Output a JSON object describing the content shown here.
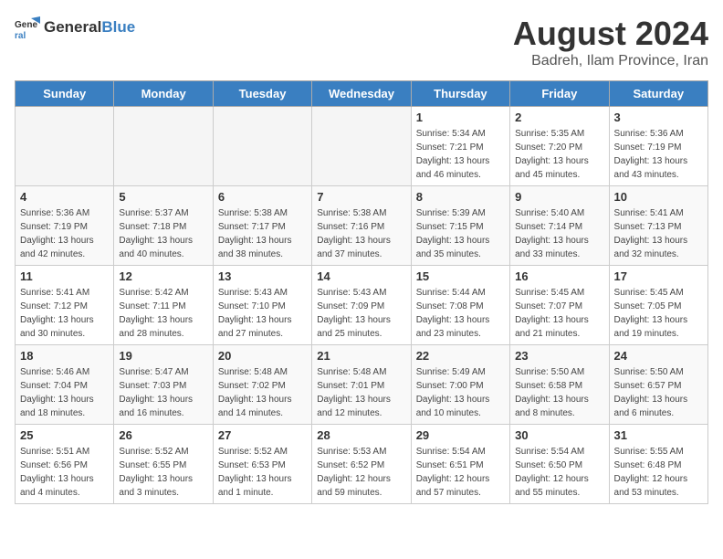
{
  "logo": {
    "text_general": "General",
    "text_blue": "Blue"
  },
  "title": "August 2024",
  "location": "Badreh, Ilam Province, Iran",
  "days_of_week": [
    "Sunday",
    "Monday",
    "Tuesday",
    "Wednesday",
    "Thursday",
    "Friday",
    "Saturday"
  ],
  "weeks": [
    [
      {
        "day": "",
        "empty": true
      },
      {
        "day": "",
        "empty": true
      },
      {
        "day": "",
        "empty": true
      },
      {
        "day": "",
        "empty": true
      },
      {
        "day": "1",
        "sunrise": "5:34 AM",
        "sunset": "7:21 PM",
        "daylight": "13 hours and 46 minutes."
      },
      {
        "day": "2",
        "sunrise": "5:35 AM",
        "sunset": "7:20 PM",
        "daylight": "13 hours and 45 minutes."
      },
      {
        "day": "3",
        "sunrise": "5:36 AM",
        "sunset": "7:19 PM",
        "daylight": "13 hours and 43 minutes."
      }
    ],
    [
      {
        "day": "4",
        "sunrise": "5:36 AM",
        "sunset": "7:19 PM",
        "daylight": "13 hours and 42 minutes."
      },
      {
        "day": "5",
        "sunrise": "5:37 AM",
        "sunset": "7:18 PM",
        "daylight": "13 hours and 40 minutes."
      },
      {
        "day": "6",
        "sunrise": "5:38 AM",
        "sunset": "7:17 PM",
        "daylight": "13 hours and 38 minutes."
      },
      {
        "day": "7",
        "sunrise": "5:38 AM",
        "sunset": "7:16 PM",
        "daylight": "13 hours and 37 minutes."
      },
      {
        "day": "8",
        "sunrise": "5:39 AM",
        "sunset": "7:15 PM",
        "daylight": "13 hours and 35 minutes."
      },
      {
        "day": "9",
        "sunrise": "5:40 AM",
        "sunset": "7:14 PM",
        "daylight": "13 hours and 33 minutes."
      },
      {
        "day": "10",
        "sunrise": "5:41 AM",
        "sunset": "7:13 PM",
        "daylight": "13 hours and 32 minutes."
      }
    ],
    [
      {
        "day": "11",
        "sunrise": "5:41 AM",
        "sunset": "7:12 PM",
        "daylight": "13 hours and 30 minutes."
      },
      {
        "day": "12",
        "sunrise": "5:42 AM",
        "sunset": "7:11 PM",
        "daylight": "13 hours and 28 minutes."
      },
      {
        "day": "13",
        "sunrise": "5:43 AM",
        "sunset": "7:10 PM",
        "daylight": "13 hours and 27 minutes."
      },
      {
        "day": "14",
        "sunrise": "5:43 AM",
        "sunset": "7:09 PM",
        "daylight": "13 hours and 25 minutes."
      },
      {
        "day": "15",
        "sunrise": "5:44 AM",
        "sunset": "7:08 PM",
        "daylight": "13 hours and 23 minutes."
      },
      {
        "day": "16",
        "sunrise": "5:45 AM",
        "sunset": "7:07 PM",
        "daylight": "13 hours and 21 minutes."
      },
      {
        "day": "17",
        "sunrise": "5:45 AM",
        "sunset": "7:05 PM",
        "daylight": "13 hours and 19 minutes."
      }
    ],
    [
      {
        "day": "18",
        "sunrise": "5:46 AM",
        "sunset": "7:04 PM",
        "daylight": "13 hours and 18 minutes."
      },
      {
        "day": "19",
        "sunrise": "5:47 AM",
        "sunset": "7:03 PM",
        "daylight": "13 hours and 16 minutes."
      },
      {
        "day": "20",
        "sunrise": "5:48 AM",
        "sunset": "7:02 PM",
        "daylight": "13 hours and 14 minutes."
      },
      {
        "day": "21",
        "sunrise": "5:48 AM",
        "sunset": "7:01 PM",
        "daylight": "13 hours and 12 minutes."
      },
      {
        "day": "22",
        "sunrise": "5:49 AM",
        "sunset": "7:00 PM",
        "daylight": "13 hours and 10 minutes."
      },
      {
        "day": "23",
        "sunrise": "5:50 AM",
        "sunset": "6:58 PM",
        "daylight": "13 hours and 8 minutes."
      },
      {
        "day": "24",
        "sunrise": "5:50 AM",
        "sunset": "6:57 PM",
        "daylight": "13 hours and 6 minutes."
      }
    ],
    [
      {
        "day": "25",
        "sunrise": "5:51 AM",
        "sunset": "6:56 PM",
        "daylight": "13 hours and 4 minutes."
      },
      {
        "day": "26",
        "sunrise": "5:52 AM",
        "sunset": "6:55 PM",
        "daylight": "13 hours and 3 minutes."
      },
      {
        "day": "27",
        "sunrise": "5:52 AM",
        "sunset": "6:53 PM",
        "daylight": "13 hours and 1 minute."
      },
      {
        "day": "28",
        "sunrise": "5:53 AM",
        "sunset": "6:52 PM",
        "daylight": "12 hours and 59 minutes."
      },
      {
        "day": "29",
        "sunrise": "5:54 AM",
        "sunset": "6:51 PM",
        "daylight": "12 hours and 57 minutes."
      },
      {
        "day": "30",
        "sunrise": "5:54 AM",
        "sunset": "6:50 PM",
        "daylight": "12 hours and 55 minutes."
      },
      {
        "day": "31",
        "sunrise": "5:55 AM",
        "sunset": "6:48 PM",
        "daylight": "12 hours and 53 minutes."
      }
    ]
  ]
}
